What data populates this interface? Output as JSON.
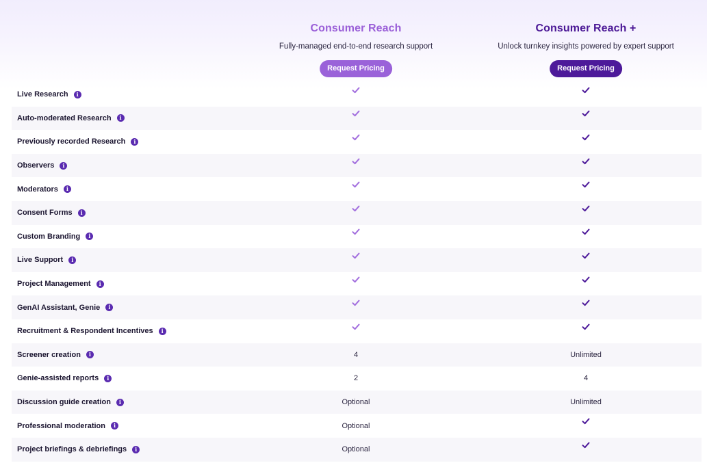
{
  "plans": [
    {
      "name": "Consumer Reach",
      "description": "Fully-managed end-to-end research support",
      "button_label": "Request Pricing"
    },
    {
      "name": "Consumer Reach +",
      "description": "Unlock turnkey insights powered by expert support",
      "button_label": "Request Pricing"
    }
  ],
  "icons": {
    "info": "info-icon",
    "check": "checkmark-icon"
  },
  "colors": {
    "plan1_accent": "#9a5fd8",
    "plan2_accent": "#4b1896",
    "info_icon": "#5a2bb0"
  },
  "features": [
    {
      "label": "Live Research",
      "plan1": "check",
      "plan2": "check"
    },
    {
      "label": "Auto-moderated Research",
      "plan1": "check",
      "plan2": "check"
    },
    {
      "label": "Previously recorded Research",
      "plan1": "check",
      "plan2": "check"
    },
    {
      "label": "Observers",
      "plan1": "check",
      "plan2": "check"
    },
    {
      "label": "Moderators",
      "plan1": "check",
      "plan2": "check"
    },
    {
      "label": "Consent Forms",
      "plan1": "check",
      "plan2": "check"
    },
    {
      "label": "Custom Branding",
      "plan1": "check",
      "plan2": "check"
    },
    {
      "label": "Live Support",
      "plan1": "check",
      "plan2": "check"
    },
    {
      "label": "Project Management",
      "plan1": "check",
      "plan2": "check"
    },
    {
      "label": "GenAI Assistant, Genie",
      "plan1": "check",
      "plan2": "check"
    },
    {
      "label": "Recruitment & Respondent Incentives",
      "plan1": "check",
      "plan2": "check"
    },
    {
      "label": "Screener creation",
      "plan1": "4",
      "plan2": "Unlimited"
    },
    {
      "label": "Genie-assisted reports",
      "plan1": "2",
      "plan2": "4"
    },
    {
      "label": "Discussion guide creation",
      "plan1": "Optional",
      "plan2": "Unlimited"
    },
    {
      "label": "Professional moderation",
      "plan1": "Optional",
      "plan2": "check"
    },
    {
      "label": "Project briefings & debriefings",
      "plan1": "Optional",
      "plan2": "check"
    }
  ]
}
